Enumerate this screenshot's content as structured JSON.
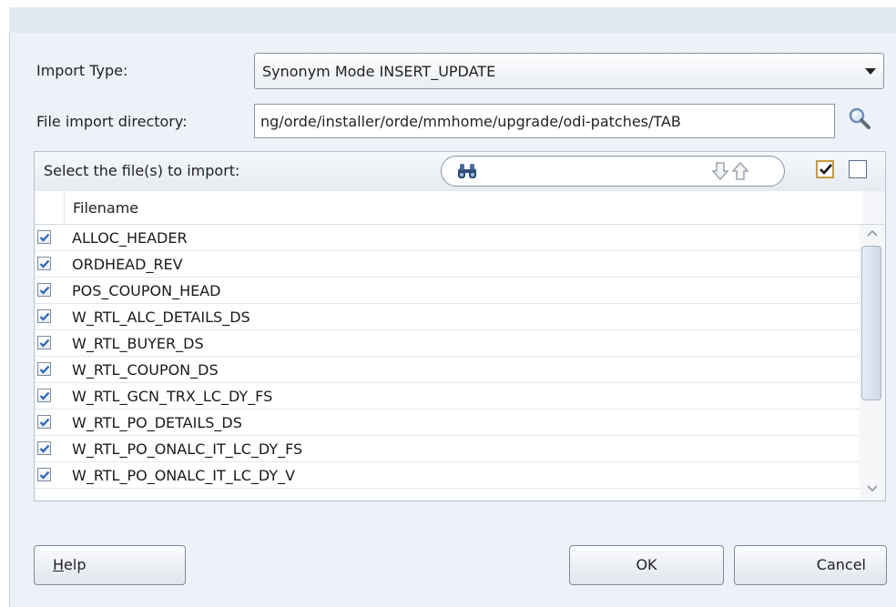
{
  "form": {
    "import_type_label": "Import Type:",
    "import_type_value": "Synonym Mode INSERT_UPDATE",
    "directory_label": "File import directory:",
    "directory_value": "ng/orde/installer/orde/mmhome/upgrade/odi-patches/TAB"
  },
  "file_panel": {
    "title": "Select the file(s) to import:",
    "filter_value": "",
    "column_header": "Filename",
    "files": [
      {
        "name": "ALLOC_HEADER",
        "checked": true
      },
      {
        "name": "ORDHEAD_REV",
        "checked": true
      },
      {
        "name": "POS_COUPON_HEAD",
        "checked": true
      },
      {
        "name": "W_RTL_ALC_DETAILS_DS",
        "checked": true
      },
      {
        "name": "W_RTL_BUYER_DS",
        "checked": true
      },
      {
        "name": "W_RTL_COUPON_DS",
        "checked": true
      },
      {
        "name": "W_RTL_GCN_TRX_LC_DY_FS",
        "checked": true
      },
      {
        "name": "W_RTL_PO_DETAILS_DS",
        "checked": true
      },
      {
        "name": "W_RTL_PO_ONALC_IT_LC_DY_FS",
        "checked": true
      },
      {
        "name": "W_RTL_PO_ONALC_IT_LC_DY_V",
        "checked": true
      }
    ]
  },
  "buttons": {
    "help_mnemonic": "H",
    "help_rest": "elp",
    "ok": "OK",
    "cancel": "Cancel"
  },
  "icons": {
    "browse": "magnifier-icon",
    "filter": "binoculars-icon",
    "sort_down": "arrow-down-icon",
    "sort_up": "arrow-up-icon",
    "select_all": "check-all-icon",
    "select_none": "uncheck-all-icon"
  },
  "colors": {
    "dialog_bg": "#eef2f8",
    "check_blue": "#2a63b8",
    "select_all_border": "#c89a3c"
  }
}
